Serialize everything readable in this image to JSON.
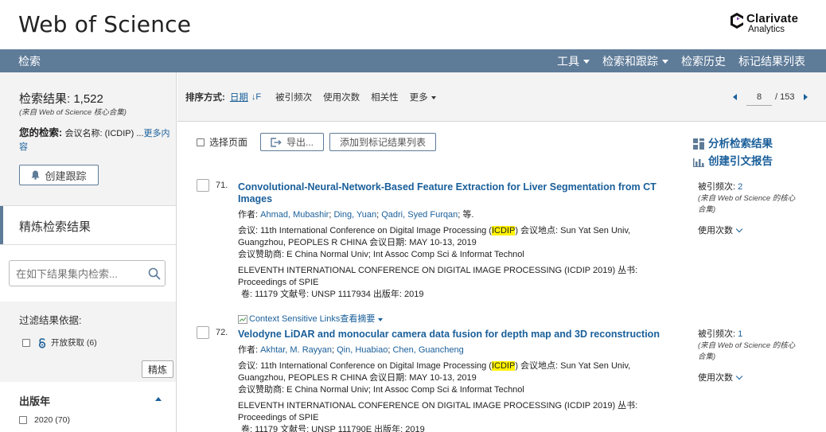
{
  "header": {
    "brand": "Web of Science",
    "logo_line1": "Clarivate",
    "logo_line2": "Analytics"
  },
  "nav": {
    "search": "检索",
    "tools": "工具",
    "search_alert": "检索和跟踪",
    "history": "检索历史",
    "marked_list": "标记结果列表"
  },
  "sidebar": {
    "results_label": "检索结果: 1,522",
    "results_source": "(来自 Web of Science 核心合集)",
    "your_search_label": "您的检索:",
    "your_search_query": "会议名称: (ICDIP) ...",
    "more_link": "更多内容",
    "create_alert": "创建跟踪",
    "refine_title": "精炼检索结果",
    "search_within_placeholder": "在如下结果集内检索...",
    "filter_label": "过滤结果依据:",
    "open_access": "开放获取 (6)",
    "refine_button": "精炼",
    "pub_year_title": "出版年",
    "pub_year_item": "2020 (70)"
  },
  "sort": {
    "label": "排序方式:",
    "active": "日期",
    "active_arrow": "↓F",
    "options": [
      "被引频次",
      "使用次数",
      "相关性",
      "更多"
    ]
  },
  "pager": {
    "current": "8",
    "total": "/ 153"
  },
  "toolbar": {
    "select_page": "选择页面",
    "export": "导出...",
    "add_marked": "添加到标记结果列表",
    "analyze": "分析检索结果",
    "citation_report": "创建引文报告"
  },
  "records": [
    {
      "num": "71.",
      "title": "Convolutional-Neural-Network-Based Feature Extraction for Liver Segmentation from CT Images",
      "authors_label": "作者:",
      "authors": [
        "Ahmad, Mubashir",
        "Ding, Yuan",
        "Qadri, Syed Furqan"
      ],
      "authors_suffix": "等.",
      "conf_pre": "会议: 11th International Conference on Digital Image Processing (",
      "conf_hl": "ICDIP",
      "conf_post": ") 会议地点: Sun Yat Sen Univ, Guangzhou, PEOPLES R CHINA 会议日期: MAY 10-13, 2019",
      "sponsor": "会议赞助商: E China Normal Univ; Int Assoc Comp Sci & Informat Technol",
      "proceedings": "ELEVENTH INTERNATIONAL CONFERENCE ON DIGITAL IMAGE PROCESSING (ICDIP 2019) 丛书: Proceedings of SPIE",
      "volume": "卷: 11179   文献号: UNSP 1117934  出版年: 2019",
      "csl": "Context Sensitive Links",
      "abstract": "查看摘要",
      "times_cited_label": "被引频次:",
      "times_cited": "2",
      "side_source": "(来自 Web of Science 的核心合集)",
      "usage": "使用次数"
    },
    {
      "num": "72.",
      "title": "Velodyne LiDAR and monocular camera data fusion for depth map and 3D reconstruction",
      "authors_label": "作者:",
      "authors": [
        "Akhtar, M. Rayyan",
        "Qin, Huabiao",
        "Chen, Guancheng"
      ],
      "authors_suffix": "",
      "conf_pre": "会议: 11th International Conference on Digital Image Processing (",
      "conf_hl": "ICDIP",
      "conf_post": ") 会议地点: Sun Yat Sen Univ, Guangzhou, PEOPLES R CHINA 会议日期: MAY 10-13, 2019",
      "sponsor": "会议赞助商: E China Normal Univ; Int Assoc Comp Sci & Informat Technol",
      "proceedings": "ELEVENTH INTERNATIONAL CONFERENCE ON DIGITAL IMAGE PROCESSING (ICDIP 2019) 丛书: Proceedings of SPIE",
      "volume": "卷: 11179   文献号: UNSP 111790E  出版年: 2019",
      "times_cited_label": "被引频次:",
      "times_cited": "1",
      "side_source": "(来自 Web of Science 的核心合集)",
      "usage": "使用次数"
    }
  ]
}
